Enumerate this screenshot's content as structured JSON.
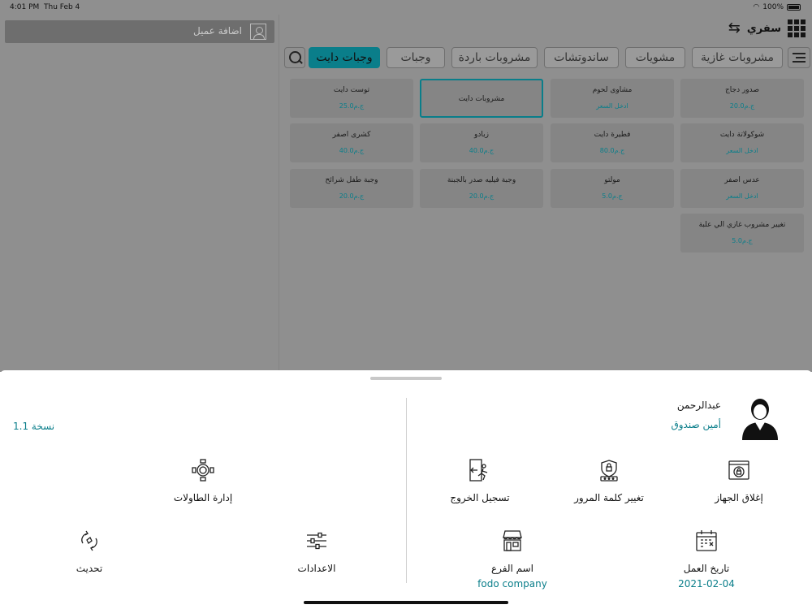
{
  "status_bar": {
    "time": "4:01 PM",
    "date": "Thu Feb 4",
    "battery": "100%"
  },
  "customer": {
    "add_label": "اضافة عميل"
  },
  "header": {
    "mode_label": "سفري"
  },
  "tabs": [
    {
      "label": "مشروبات غازية",
      "active": false
    },
    {
      "label": "مشويات",
      "active": false
    },
    {
      "label": "ساندوتشات",
      "active": false
    },
    {
      "label": "مشروبات باردة",
      "active": false
    },
    {
      "label": "وجبات",
      "active": false
    },
    {
      "label": "وجبات دايت",
      "active": true
    }
  ],
  "products": [
    {
      "name": "صدور دجاج",
      "price": "20.0ج.م"
    },
    {
      "name": "مشاوى لحوم",
      "price": "ادخل السعر"
    },
    {
      "name": "مشروبات دايت",
      "price": ""
    },
    {
      "name": "توست دايت",
      "price": "25.0ج.م"
    },
    {
      "name": "شوكولاتة دايت",
      "price": "ادخل السعر"
    },
    {
      "name": "فطيرة دايت",
      "price": "80.0ج.م"
    },
    {
      "name": "زبادو",
      "price": "40.0ج.م"
    },
    {
      "name": "كشرى اصفر",
      "price": "40.0ج.م"
    },
    {
      "name": "عدس اصفر",
      "price": "ادخل السعر"
    },
    {
      "name": "مولتو",
      "price": "5.0ج.م"
    },
    {
      "name": "وجبة فيليه صدر بالجبنة",
      "price": "20.0ج.م"
    },
    {
      "name": "وجبة طفل شرائح",
      "price": "20.0ج.م"
    },
    {
      "name": "تغيير مشروب غازي الي علبة",
      "price": "5.0ج.م"
    }
  ],
  "sheet": {
    "user_name": "عبدالرحمن",
    "user_role": "أمين صندوق",
    "version": "نسخة 1.1",
    "actions": {
      "lock": {
        "label": "إغلاق الجهاز",
        "icon": "lock-device-icon"
      },
      "password": {
        "label": "تغيير كلمة المرور",
        "icon": "password-icon"
      },
      "logout": {
        "label": "تسجيل الخروج",
        "icon": "logout-icon"
      },
      "tables": {
        "label": "إدارة الطاولات",
        "icon": "table-icon"
      },
      "work_date": {
        "label": "تاريخ العمل",
        "value": "2021-02-04",
        "icon": "calendar-icon"
      },
      "branch": {
        "label": "اسم الفرع",
        "value": "fodo company",
        "icon": "store-icon"
      },
      "settings": {
        "label": "الاعدادات",
        "icon": "sliders-icon"
      },
      "refresh": {
        "label": "تحديث",
        "icon": "refresh-icon"
      }
    }
  },
  "colors": {
    "accent": "#0a7e8a",
    "dim_overlay": "#8f8f8f"
  }
}
